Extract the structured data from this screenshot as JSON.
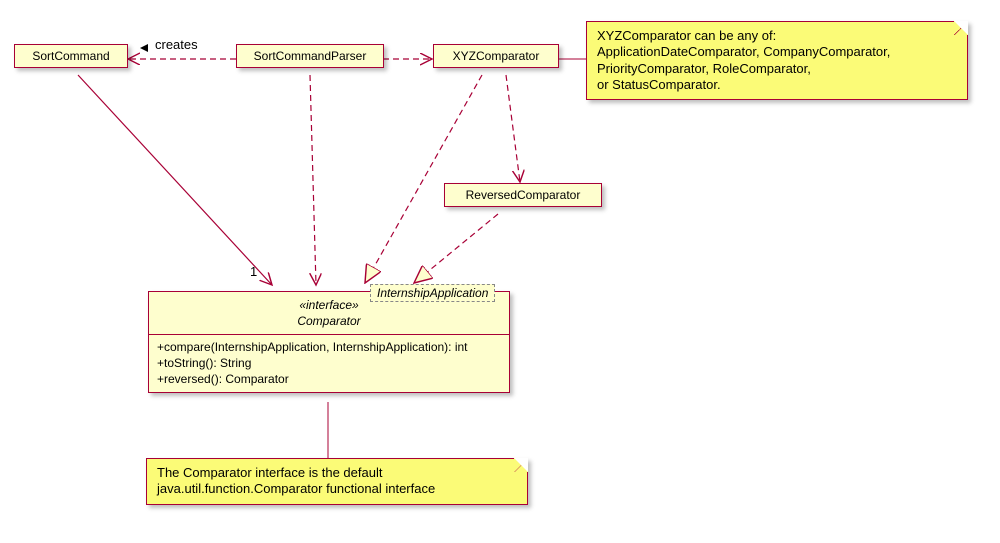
{
  "classes": {
    "sortCommand": "SortCommand",
    "sortCommandParser": "SortCommandParser",
    "xyzComparator": "XYZComparator",
    "reversedComparator": "ReversedComparator"
  },
  "interface": {
    "stereotype": "«interface»",
    "name": "Comparator",
    "templateParam": "InternshipApplication",
    "ops": [
      "+compare(InternshipApplication, InternshipApplication): int",
      "+toString(): String",
      "+reversed(): Comparator"
    ]
  },
  "notes": {
    "xyz": "XYZComparator can be any of:\nApplicationDateComparator, CompanyComparator,\nPriorityComparator, RoleComparator,\nor StatusComparator.",
    "comparator": "The Comparator interface is the default\njava.util.function.Comparator functional interface"
  },
  "labels": {
    "creates": "creates",
    "one": "1"
  },
  "chart_data": {
    "type": "uml-class-diagram",
    "elements": [
      {
        "id": "SortCommand",
        "kind": "class"
      },
      {
        "id": "SortCommandParser",
        "kind": "class"
      },
      {
        "id": "XYZComparator",
        "kind": "class"
      },
      {
        "id": "ReversedComparator",
        "kind": "class"
      },
      {
        "id": "Comparator",
        "kind": "interface",
        "templateParam": "InternshipApplication",
        "operations": [
          "+compare(InternshipApplication, InternshipApplication): int",
          "+toString(): String",
          "+reversed(): Comparator"
        ]
      }
    ],
    "notes": [
      {
        "attachedTo": "XYZComparator",
        "text": "XYZComparator can be any of: ApplicationDateComparator, CompanyComparator, PriorityComparator, RoleComparator, or StatusComparator."
      },
      {
        "attachedTo": "Comparator",
        "text": "The Comparator interface is the default java.util.function.Comparator functional interface"
      }
    ],
    "relations": [
      {
        "from": "SortCommandParser",
        "to": "SortCommand",
        "kind": "dependency",
        "label": "creates",
        "style": "dashed-open-arrow"
      },
      {
        "from": "SortCommandParser",
        "to": "XYZComparator",
        "kind": "dependency",
        "style": "dashed-open-arrow"
      },
      {
        "from": "SortCommandParser",
        "to": "Comparator",
        "kind": "dependency",
        "style": "dashed-open-arrow"
      },
      {
        "from": "SortCommand",
        "to": "Comparator",
        "kind": "association",
        "multiplicity": "1",
        "style": "solid-open-arrow"
      },
      {
        "from": "XYZComparator",
        "to": "Comparator",
        "kind": "realization",
        "style": "dashed-hollow-triangle"
      },
      {
        "from": "XYZComparator",
        "to": "ReversedComparator",
        "kind": "dependency",
        "style": "dashed-open-arrow"
      },
      {
        "from": "ReversedComparator",
        "to": "Comparator",
        "kind": "realization",
        "style": "dashed-hollow-triangle"
      }
    ]
  }
}
